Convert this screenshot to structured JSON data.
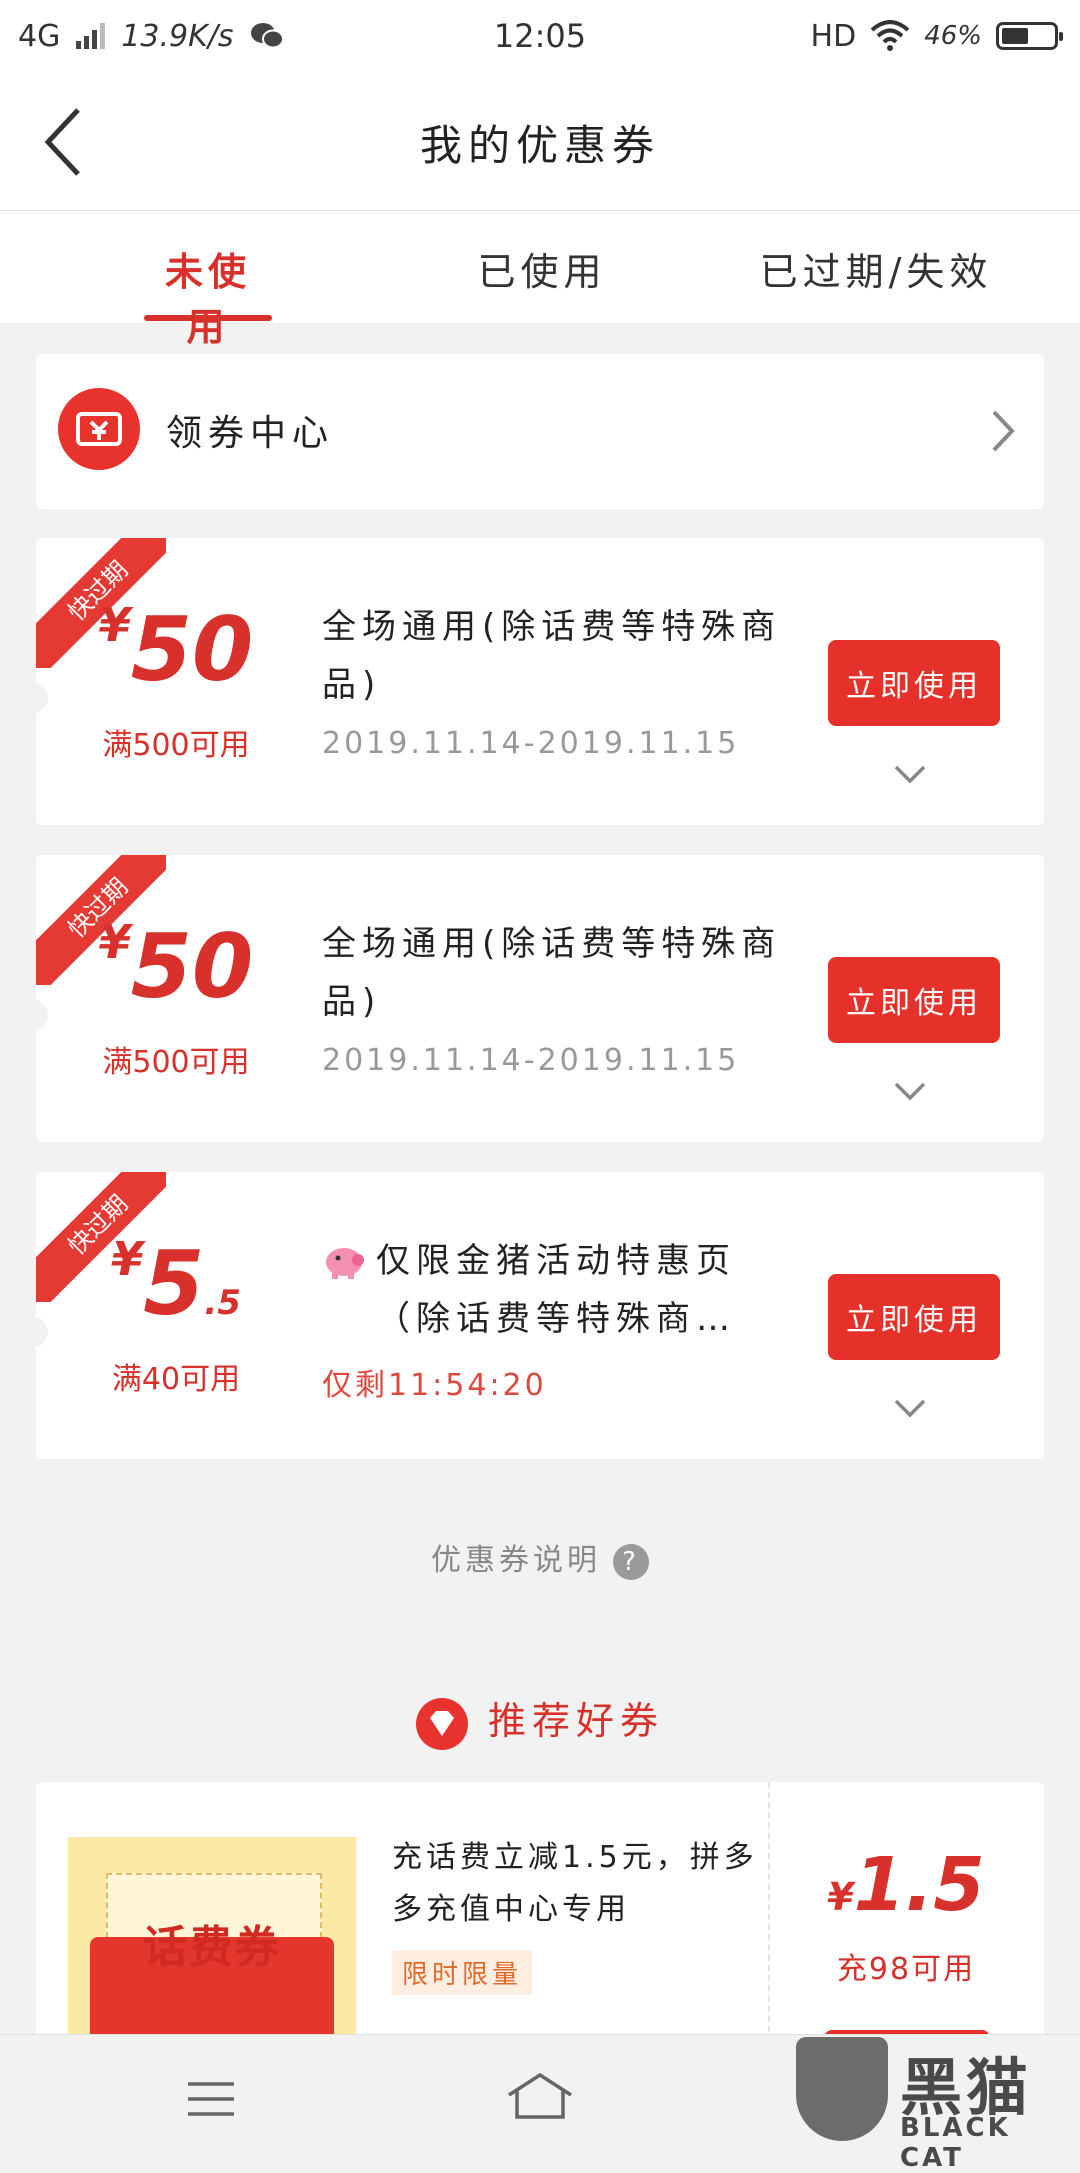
{
  "status_bar": {
    "network": "4G",
    "speed": "13.9K/s",
    "time": "12:05",
    "hd": "HD",
    "battery": "46%",
    "battery_level": 0.46
  },
  "header": {
    "title": "我的优惠券"
  },
  "tabs": [
    {
      "label": "未使用",
      "active": true
    },
    {
      "label": "已使用",
      "active": false
    },
    {
      "label": "已过期/失效",
      "active": false
    }
  ],
  "coupon_center": {
    "label": "领券中心"
  },
  "coupons": [
    {
      "badge": "快过期",
      "currency": "¥",
      "amount": "50",
      "decimal": "",
      "condition": "满500可用",
      "description": "全场通用(除话费等特殊商品)",
      "date": "2019.11.14-2019.11.15",
      "button": "立即使用"
    },
    {
      "badge": "快过期",
      "currency": "¥",
      "amount": "50",
      "decimal": "",
      "condition": "满500可用",
      "description": "全场通用(除话费等特殊商品)",
      "date": "2019.11.14-2019.11.15",
      "button": "立即使用"
    },
    {
      "badge": "快过期",
      "currency": "¥",
      "amount": "5",
      "decimal": ".5",
      "condition": "满40可用",
      "description": "仅限金猪活动特惠页（除话费等特殊商…",
      "countdown": "仅剩11:54:20",
      "button": "立即使用"
    }
  ],
  "explain": {
    "label": "优惠券说明",
    "icon": "question-icon"
  },
  "recommend": {
    "title": "推荐好券",
    "card": {
      "image_text": "话费券",
      "description": "充话费立减1.5元，拼多多充值中心专用",
      "tag": "限时限量",
      "currency": "¥",
      "amount": "1.5",
      "condition": "充98可用"
    }
  },
  "watermark": {
    "cn": "黑猫",
    "en": "BLACK CAT"
  },
  "colors": {
    "accent": "#d8302b",
    "button": "#e53129",
    "background": "#f2f2f2"
  }
}
